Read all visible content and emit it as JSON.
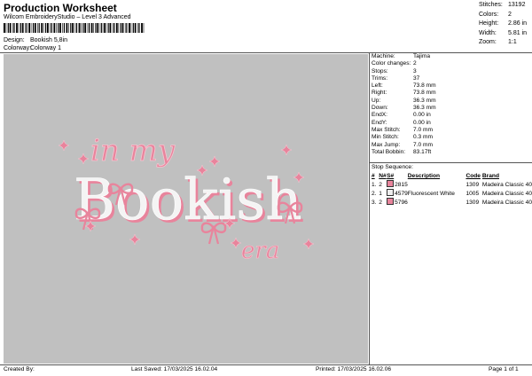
{
  "header": {
    "title": "Production Worksheet",
    "subtitle": "Wilcom EmbroideryStudio – Level 3 Advanced"
  },
  "design": {
    "label": "Design:",
    "value": "Bookish 5,8in"
  },
  "colorway": {
    "label": "Colorway:",
    "value": "Colorway 1"
  },
  "stats": [
    {
      "key": "Stitches:",
      "value": "13192"
    },
    {
      "key": "Colors:",
      "value": "2"
    },
    {
      "key": "Height:",
      "value": "2.86 in"
    },
    {
      "key": "Width:",
      "value": "5.81 in"
    },
    {
      "key": "Zoom:",
      "value": "1:1"
    }
  ],
  "artwork": {
    "line1": "in my",
    "line2": "Bookish",
    "line3": "era",
    "colors": {
      "pink": "#e8849c",
      "white": "#f4f4f4",
      "background": "#c0c0c0"
    }
  },
  "machine": [
    {
      "key": "Machine:",
      "value": "Tajima"
    },
    {
      "key": "Color changes:",
      "value": "2"
    },
    {
      "key": "Stops:",
      "value": "3"
    },
    {
      "key": "Trims:",
      "value": "37"
    },
    {
      "key": "Left:",
      "value": "73.8 mm"
    },
    {
      "key": "Right:",
      "value": "73.8 mm"
    },
    {
      "key": "Up:",
      "value": "36.3 mm"
    },
    {
      "key": "Down:",
      "value": "36.3 mm"
    },
    {
      "key": "EndX:",
      "value": "0.00 in"
    },
    {
      "key": "EndY:",
      "value": "0.00 in"
    },
    {
      "key": "Max Stitch:",
      "value": "7.0 mm"
    },
    {
      "key": "Min Stitch:",
      "value": "0.3 mm"
    },
    {
      "key": "Max Jump:",
      "value": "7.0 mm"
    },
    {
      "key": "Total Bobbin:",
      "value": "83.17ft"
    }
  ],
  "stop_sequence": {
    "title": "Stop Sequence:",
    "headers": [
      "#",
      "N#",
      "S#",
      "Description",
      "Code",
      "Brand"
    ],
    "rows": [
      {
        "num": "1.",
        "n": "2",
        "color": "#e8849c",
        "s": "2815",
        "desc": "",
        "code": "1309",
        "brand": "Madeira Classic 40"
      },
      {
        "num": "2.",
        "n": "1",
        "color": "#eeeeee",
        "s": "4579",
        "desc": "Fluorescent White",
        "code": "1005",
        "brand": "Madeira Classic 40"
      },
      {
        "num": "3.",
        "n": "2",
        "color": "#e8849c",
        "s": "5796",
        "desc": "",
        "code": "1309",
        "brand": "Madeira Classic 40"
      }
    ]
  },
  "footer": {
    "created": "Created By:",
    "saved": "Last Saved: 17/03/2025 16.02.04",
    "printed": "Printed: 17/03/2025 16.02.06",
    "page": "Page 1 of 1"
  }
}
